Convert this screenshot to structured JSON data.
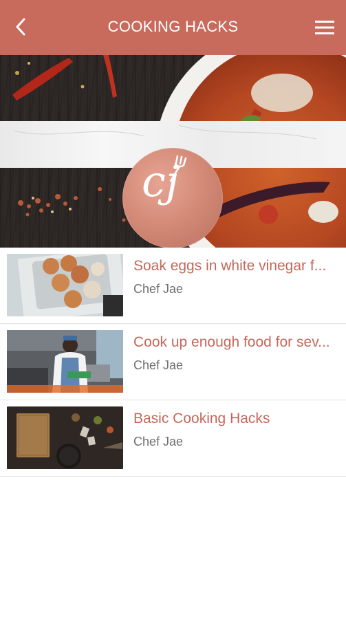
{
  "theme": {
    "accent": "#c86a5c",
    "title_color": "#c5675a",
    "author_color": "#707070"
  },
  "appbar": {
    "back_icon": "chevron-left-icon",
    "title": "COOKING HACKS",
    "menu_icon": "hamburger-menu-icon"
  },
  "hero": {
    "logo_text": "cj",
    "logo_icon": "fork-icon"
  },
  "list": {
    "items": [
      {
        "title": "Soak eggs in white vinegar f...",
        "author": "Chef Jae",
        "thumbnail": "eggs-in-carton"
      },
      {
        "title": "Cook up enough food for sev...",
        "author": "Chef Jae",
        "thumbnail": "chef-in-kitchen"
      },
      {
        "title": "Basic Cooking Hacks",
        "author": "Chef Jae",
        "thumbnail": "cutting-board-and-spices"
      }
    ]
  }
}
